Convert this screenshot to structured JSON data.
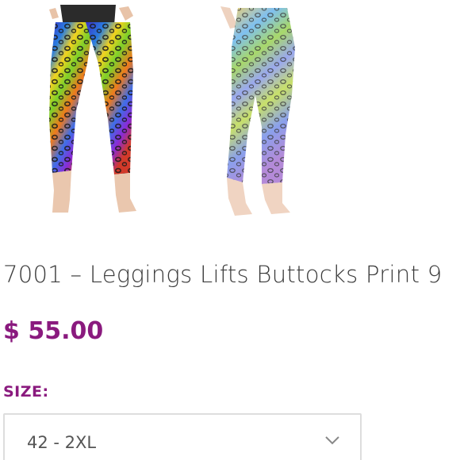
{
  "product": {
    "title": "7001 – Leggings Lifts Buttocks Print 9",
    "price": "$ 55.00",
    "image_icon": "leggings-photo",
    "brand_color": "#8a1a7e"
  },
  "options": {
    "size_label": "SIZE:",
    "size_selected": "42 - 2XL",
    "dropdown_icon": "chevron-down-icon"
  }
}
